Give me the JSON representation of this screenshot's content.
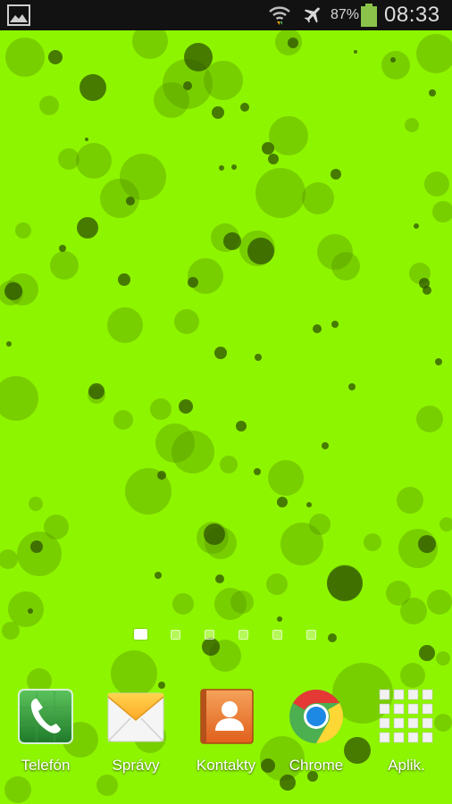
{
  "status_bar": {
    "battery_percent": "87%",
    "time": "08:33",
    "icons": [
      "gallery-notification-icon",
      "wifi-icon",
      "airplane-mode-icon",
      "battery-icon"
    ]
  },
  "home": {
    "page_count": 6,
    "active_page": 0
  },
  "dock": {
    "items": [
      {
        "label": "Telefón",
        "icon": "phone-icon"
      },
      {
        "label": "Správy",
        "icon": "messages-icon"
      },
      {
        "label": "Kontakty",
        "icon": "contacts-icon"
      },
      {
        "label": "Chrome",
        "icon": "chrome-icon"
      },
      {
        "label": "Aplik.",
        "icon": "apps-grid-icon"
      }
    ]
  },
  "colors": {
    "wallpaper": "#8ef500",
    "status_bar": "#121212"
  }
}
